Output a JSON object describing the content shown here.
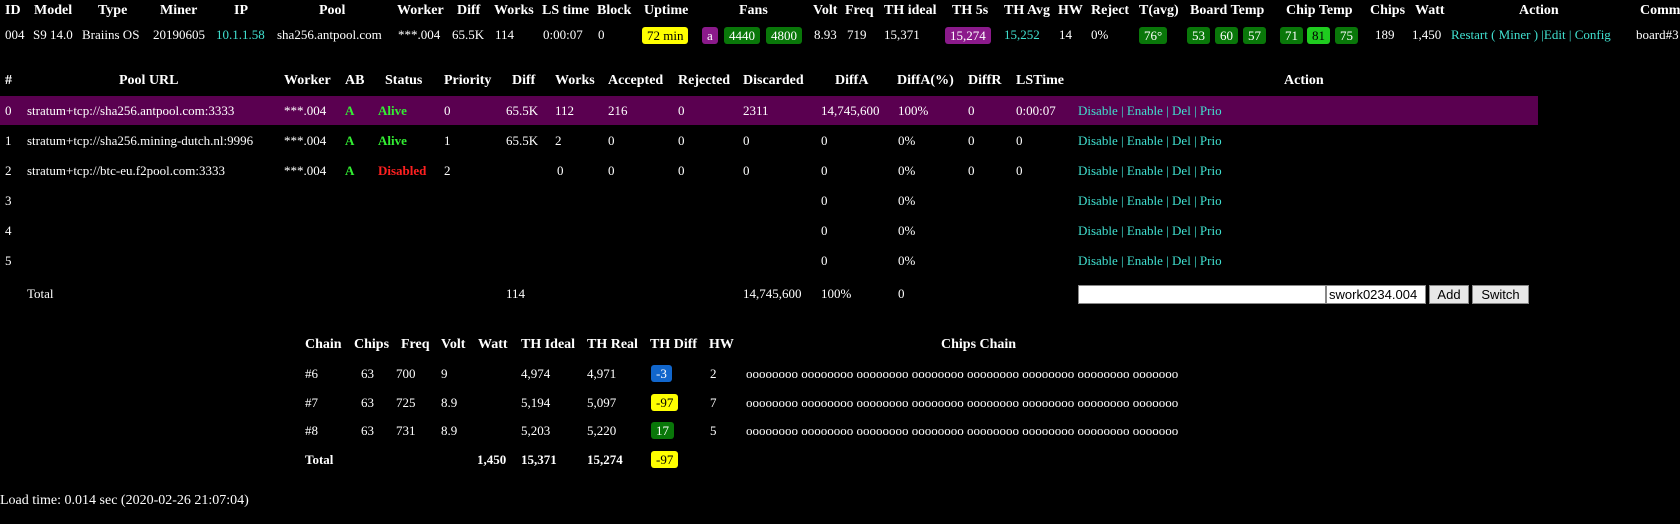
{
  "miner_table": {
    "headers": [
      "ID",
      "Model",
      "Type",
      "Miner",
      "IP",
      "Pool",
      "Worker",
      "Diff",
      "Works",
      "LS time",
      "Block",
      "Uptime",
      "Fans",
      "Volt",
      "Freq",
      "TH ideal",
      "TH 5s",
      "TH Avg",
      "HW",
      "Reject",
      "T(avg)",
      "Board Temp",
      "Chip Temp",
      "Chips",
      "Watt",
      "Action",
      "Comm"
    ],
    "row": {
      "id": "004",
      "model": "S9 14.0",
      "type": "Braiins OS",
      "miner": "20190605",
      "ip": "10.1.1.58",
      "pool": "sha256.antpool.com",
      "worker": "***.004",
      "diff": "65.5K",
      "works": "114",
      "ls_time": "0:00:07",
      "block": "0",
      "uptime": "72 min",
      "fan_a": "a",
      "fan1": "4440",
      "fan2": "4800",
      "volt": "8.93",
      "freq": "719",
      "th_ideal": "15,371",
      "th_5s": "15,274",
      "th_avg": "15,252",
      "hw": "14",
      "reject": "0%",
      "t_avg": "76°",
      "board_temps": [
        "53",
        "60",
        "57"
      ],
      "chip_temps": [
        "71",
        "81",
        "75"
      ],
      "chips": "189",
      "watt": "1,450",
      "action": {
        "restart": "Restart",
        "open_paren": "(",
        "miner": "Miner",
        "close_paren": ")",
        "sep1": "|",
        "edit": "Edit",
        "sep2": "|",
        "config": "Config"
      },
      "comm": "board#3"
    }
  },
  "pool_table": {
    "headers": [
      "#",
      "Pool URL",
      "Worker",
      "AB",
      "Status",
      "Priority",
      "Diff",
      "Works",
      "Accepted",
      "Rejected",
      "Discarded",
      "DiffA",
      "DiffA(%)",
      "DiffR",
      "LSTime",
      "Action"
    ],
    "rows": [
      {
        "n": "0",
        "url": "stratum+tcp://sha256.antpool.com:3333",
        "worker": "***.004",
        "ab": "A",
        "status": "Alive",
        "priority": "0",
        "diff": "65.5K",
        "works": "112",
        "accepted": "216",
        "rejected": "0",
        "discarded": "2311",
        "diffa": "14,745,600",
        "diffa_pct": "100%",
        "diffr": "0",
        "lstime": "0:00:07"
      },
      {
        "n": "1",
        "url": "stratum+tcp://sha256.mining-dutch.nl:9996",
        "worker": "***.004",
        "ab": "A",
        "status": "Alive",
        "priority": "1",
        "diff": "65.5K",
        "works": "2",
        "accepted": "0",
        "rejected": "0",
        "discarded": "0",
        "diffa": "0",
        "diffa_pct": "0%",
        "diffr": "0",
        "lstime": "0"
      },
      {
        "n": "2",
        "url": "stratum+tcp://btc-eu.f2pool.com:3333",
        "worker": "***.004",
        "ab": "A",
        "status": "Disabled",
        "priority": "2",
        "diff": "",
        "works": "0",
        "accepted": "0",
        "rejected": "0",
        "discarded": "0",
        "diffa": "0",
        "diffa_pct": "0%",
        "diffr": "0",
        "lstime": "0"
      },
      {
        "n": "3",
        "url": "",
        "worker": "",
        "ab": "",
        "status": "",
        "priority": "",
        "diff": "",
        "works": "",
        "accepted": "",
        "rejected": "",
        "discarded": "",
        "diffa": "0",
        "diffa_pct": "0%",
        "diffr": "",
        "lstime": ""
      },
      {
        "n": "4",
        "url": "",
        "worker": "",
        "ab": "",
        "status": "",
        "priority": "",
        "diff": "",
        "works": "",
        "accepted": "",
        "rejected": "",
        "discarded": "",
        "diffa": "0",
        "diffa_pct": "0%",
        "diffr": "",
        "lstime": ""
      },
      {
        "n": "5",
        "url": "",
        "worker": "",
        "ab": "",
        "status": "",
        "priority": "",
        "diff": "",
        "works": "",
        "accepted": "",
        "rejected": "",
        "discarded": "",
        "diffa": "0",
        "diffa_pct": "0%",
        "diffr": "",
        "lstime": ""
      }
    ],
    "action_links": {
      "disable": "Disable",
      "sep": "|",
      "enable": "Enable",
      "del": "Del",
      "prio": "Prio"
    },
    "total": {
      "label": "Total",
      "works": "114",
      "diffa": "14,745,600",
      "diffa_pct": "100%",
      "diffr": "0"
    },
    "add_pool": {
      "url_value": "",
      "worker_value": "swork0234.004",
      "add_label": "Add",
      "switch_label": "Switch"
    }
  },
  "chain_table": {
    "headers": [
      "Chain",
      "Chips",
      "Freq",
      "Volt",
      "Watt",
      "TH Ideal",
      "TH Real",
      "TH Diff",
      "HW",
      "Chips Chain"
    ],
    "rows": [
      {
        "chain": "#6",
        "chips": "63",
        "freq": "700",
        "volt": "9",
        "watt": "",
        "th_ideal": "4,974",
        "th_real": "4,971",
        "th_diff": "-3",
        "hw": "2",
        "chips_chain": "oooooooo oooooooo oooooooo oooooooo oooooooo oooooooo oooooooo ooooooo"
      },
      {
        "chain": "#7",
        "chips": "63",
        "freq": "725",
        "volt": "8.9",
        "watt": "",
        "th_ideal": "5,194",
        "th_real": "5,097",
        "th_diff": "-97",
        "hw": "7",
        "chips_chain": "oooooooo oooooooo oooooooo oooooooo oooooooo oooooooo oooooooo ooooooo"
      },
      {
        "chain": "#8",
        "chips": "63",
        "freq": "731",
        "volt": "8.9",
        "watt": "",
        "th_ideal": "5,203",
        "th_real": "5,220",
        "th_diff": "17",
        "hw": "5",
        "chips_chain": "oooooooo oooooooo oooooooo oooooooo oooooooo oooooooo oooooooo ooooooo"
      }
    ],
    "total": {
      "label": "Total",
      "watt": "1,450",
      "th_ideal": "15,371",
      "th_real": "15,274",
      "th_diff": "-97"
    }
  },
  "footer": {
    "load_time": "Load time: 0.014 sec (2020-02-26 21:07:04)"
  },
  "colors": {
    "link": "#40e0d0",
    "selected_row": "#5a0050",
    "alive": "#33ee33",
    "disabled": "#ff2020"
  }
}
